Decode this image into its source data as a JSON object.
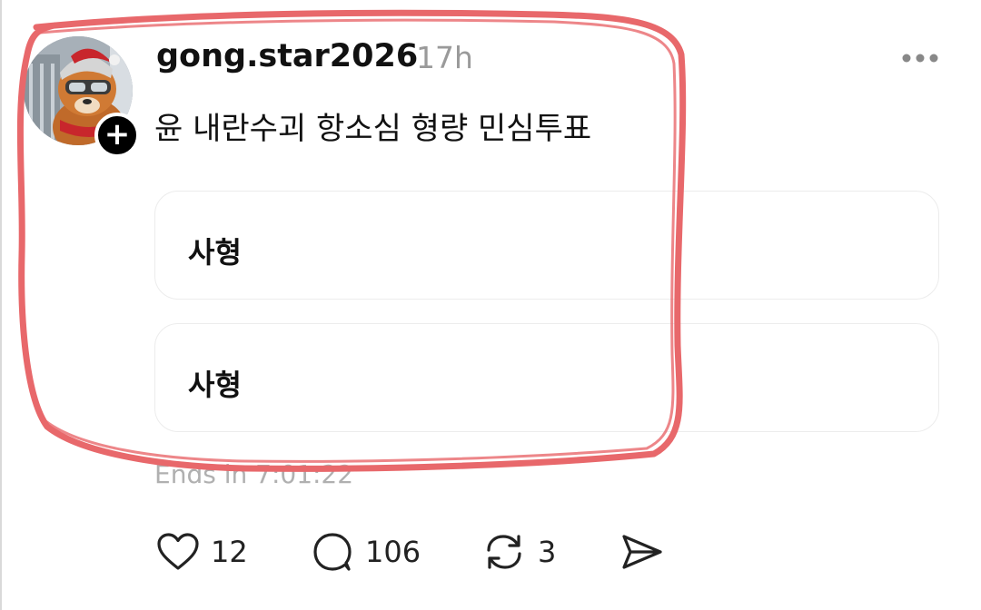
{
  "post": {
    "username": "gong.star2026",
    "time": "17h",
    "text": "윤 내란수괴 항소심 형량 민심투표",
    "poll_options": [
      "사형",
      "사형"
    ],
    "ends_text": "Ends in 7:01:22"
  },
  "actions": {
    "likes": "12",
    "replies": "106",
    "reposts": "3"
  },
  "icons": {
    "more": "more-horizontal-icon",
    "like": "heart-icon",
    "reply": "comment-icon",
    "repost": "repost-icon",
    "share": "send-icon",
    "follow": "plus-icon"
  },
  "colors": {
    "annotation": "#e8686b",
    "muted_text": "#9a9a9a",
    "border": "#ececec"
  }
}
